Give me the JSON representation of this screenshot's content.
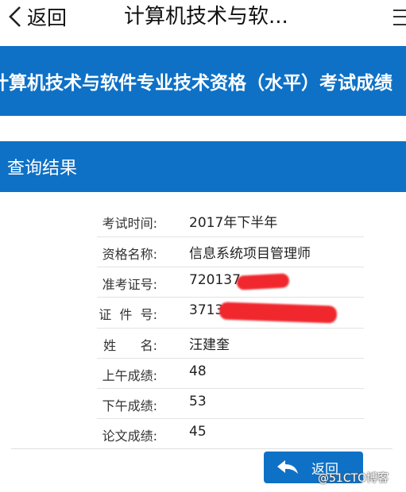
{
  "nav": {
    "back_label": "返回",
    "title": "计算机技术与软..."
  },
  "banner": {
    "title": "计算机技术与软件专业技术资格（水平）考试成绩"
  },
  "section": {
    "title": "查询结果"
  },
  "results": [
    {
      "label": "考试时间:",
      "value": "2017年下半年"
    },
    {
      "label": "资格名称:",
      "value": "信息系统项目管理师"
    },
    {
      "label": "准考证号:",
      "value": "720137"
    },
    {
      "label": "证  件  号:",
      "value": "3713"
    },
    {
      "label": "姓      名:",
      "value": "汪建奎"
    },
    {
      "label": "上午成绩:",
      "value": "48"
    },
    {
      "label": "下午成绩:",
      "value": "53"
    },
    {
      "label": "论文成绩:",
      "value": "45"
    }
  ],
  "footer": {
    "back_button_label": "返回",
    "watermark": "@51CTO博客"
  },
  "colors": {
    "brand_blue": "#0e71c6",
    "redaction": "#f0282e"
  }
}
